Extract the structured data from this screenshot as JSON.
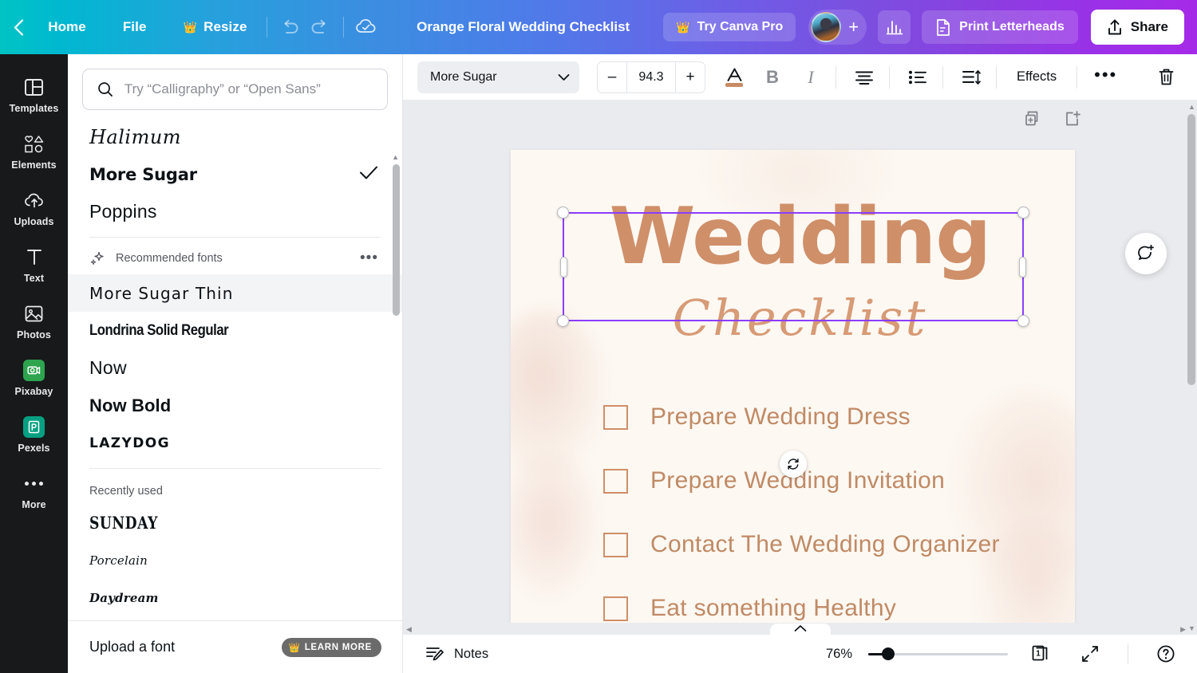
{
  "topbar": {
    "back_icon": "chevron-left-icon",
    "home_label": "Home",
    "file_label": "File",
    "resize_label": "Resize",
    "resize_badge": "crown-icon",
    "undo_icon": "undo-icon",
    "redo_icon": "redo-icon",
    "cloud_saved_icon": "cloud-check-icon",
    "design_title": "Orange Floral Wedding Checklist",
    "try_pro_label": "Try Canva Pro",
    "try_pro_icon": "crown-icon",
    "avatar_icon": "user-avatar",
    "add_member_icon": "plus-icon",
    "insights_icon": "bar-chart-icon",
    "print_label": "Print Letterheads",
    "print_icon": "document-icon",
    "share_label": "Share",
    "share_icon": "share-upload-icon"
  },
  "rail": {
    "items": [
      {
        "label": "Templates",
        "icon": "templates-icon"
      },
      {
        "label": "Elements",
        "icon": "elements-icon"
      },
      {
        "label": "Uploads",
        "icon": "upload-cloud-icon"
      },
      {
        "label": "Text",
        "icon": "text-t-icon"
      },
      {
        "label": "Photos",
        "icon": "photos-image-icon"
      },
      {
        "label": "Pixabay",
        "icon": "pixabay-icon"
      },
      {
        "label": "Pexels",
        "icon": "pexels-icon"
      },
      {
        "label": "More",
        "icon": "more-dots-icon"
      }
    ],
    "pixabay_color": "#2ea44f",
    "pexels_color": "#05a081"
  },
  "font_panel": {
    "search": {
      "icon": "search-icon",
      "placeholder": "Try “Calligraphy” or “Open Sans”",
      "value": ""
    },
    "top_fonts": [
      {
        "name": "Halimum",
        "style": "f-script",
        "selected": false
      },
      {
        "name": "More Sugar",
        "style": "f-moresugar",
        "selected": true
      },
      {
        "name": "Poppins",
        "style": "f-poppins",
        "selected": false
      }
    ],
    "recommended_header": "Recommended fonts",
    "recommended_icon": "sparkle-icon",
    "recommended_more_icon": "ellipsis-icon",
    "recommended_fonts": [
      {
        "name": "More Sugar Thin",
        "style": "f-thin",
        "hovered": true
      },
      {
        "name": "Londrina Solid Regular",
        "style": "f-londrina",
        "hovered": false
      },
      {
        "name": "Now",
        "style": "f-now",
        "hovered": false
      },
      {
        "name": "Now Bold",
        "style": "f-nowbold",
        "hovered": false
      },
      {
        "name": "LAZYDOG",
        "style": "f-lazy",
        "hovered": false
      }
    ],
    "recently_used_header": "Recently used",
    "recently_used_fonts": [
      {
        "name": "SUNDAY",
        "style": "f-sunday"
      },
      {
        "name": "Porcelain",
        "style": "f-porcelain"
      },
      {
        "name": "Daydream",
        "style": "f-daydream"
      }
    ],
    "upload_label": "Upload a font",
    "learn_more_label": "LEARN MORE",
    "learn_more_icon": "crown-icon",
    "checkmark_icon": "check-icon"
  },
  "toolbar": {
    "font_name": "More Sugar",
    "font_dropdown_icon": "chevron-down-icon",
    "decrease_label": "–",
    "font_size": "94.3",
    "increase_label": "+",
    "text_color_icon": "font-color-a-icon",
    "text_color": "#c88a63",
    "bold_label": "B",
    "italic_label": "I",
    "align_icon": "align-center-icon",
    "list_icon": "bullet-list-icon",
    "spacing_icon": "line-spacing-icon",
    "effects_label": "Effects",
    "more_icon": "ellipsis-icon",
    "delete_icon": "trash-icon"
  },
  "canvas": {
    "duplicate_page_icon": "duplicate-page-icon",
    "add_page_icon": "add-page-icon",
    "rotate_icon": "rotate-handle-icon",
    "comment_icon": "add-comment-icon",
    "design": {
      "title_line1": "Wedding",
      "title_line2": "Checklist",
      "title_color": "#cf8f69",
      "subtitle_color": "#d79b76",
      "background_color": "#fdf8f2",
      "checklist_items": [
        "Prepare Wedding Dress",
        "Prepare Wedding Invitation",
        "Contact The Wedding Organizer",
        "Eat something Healthy"
      ],
      "checkbox_color": "#cf8f69",
      "item_text_color": "#c08a65"
    },
    "selection_color": "#8b3dff"
  },
  "bottom": {
    "notes_label": "Notes",
    "notes_icon": "notes-pencil-icon",
    "collapse_icon": "chevron-up-icon",
    "zoom_level": "76%",
    "page_count": "1",
    "pages_icon": "pages-icon",
    "fullscreen_icon": "expand-icon",
    "help_icon": "help-question-icon"
  }
}
